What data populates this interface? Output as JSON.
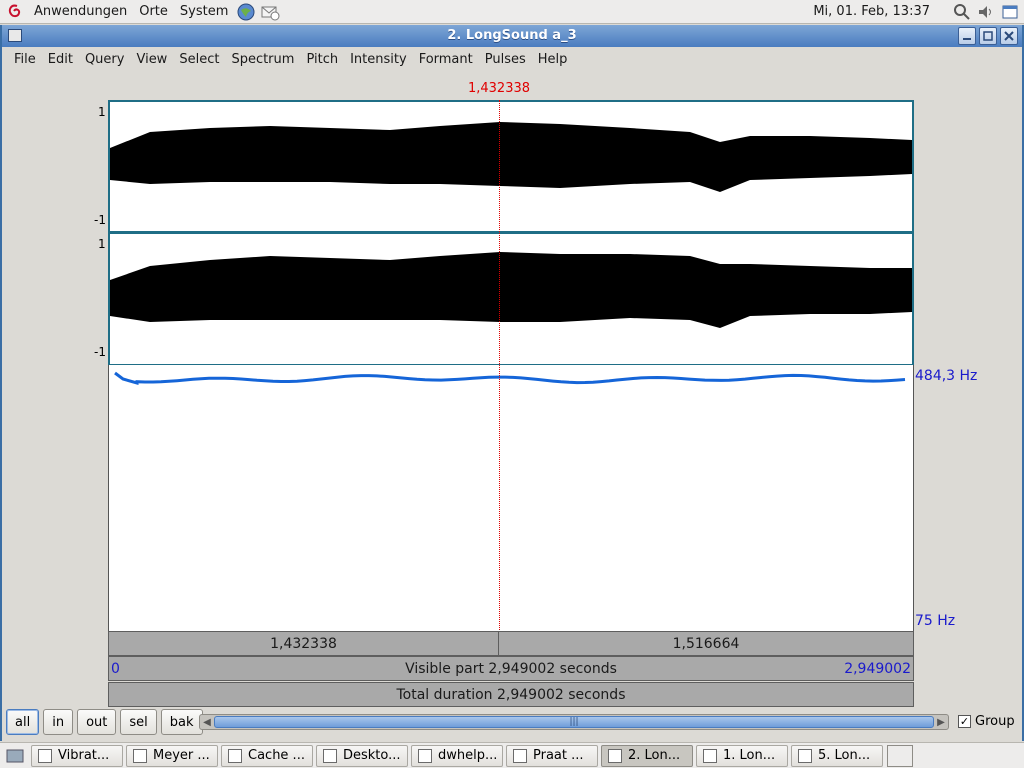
{
  "top_panel": {
    "menus": [
      "Anwendungen",
      "Orte",
      "System"
    ],
    "clock": "Mi, 01. Feb, 13:37"
  },
  "window": {
    "title": "2. LongSound a_3",
    "menubar": [
      "File",
      "Edit",
      "Query",
      "View",
      "Select",
      "Spectrum",
      "Pitch",
      "Intensity",
      "Formant",
      "Pulses",
      "Help"
    ]
  },
  "editor": {
    "cursor_time": "1,432338",
    "channel1": {
      "top": "1",
      "bottom": "-1"
    },
    "channel2": {
      "top": "1",
      "bottom": "-1"
    },
    "pitch_top": "484,3 Hz",
    "pitch_bottom": "75 Hz",
    "left_segment": "1,432338",
    "right_segment": "1,516664",
    "visible_start": "0",
    "visible_text": "Visible part 2,949002 seconds",
    "visible_end": "2,949002",
    "total_text": "Total duration 2,949002 seconds",
    "pitch_color": "#1565d8"
  },
  "controls": {
    "buttons": [
      "all",
      "in",
      "out",
      "sel",
      "bak"
    ],
    "group_label": "Group",
    "group_checked": true
  },
  "taskbar": {
    "tasks": [
      "Vibrat...",
      "Meyer ...",
      "Cache ...",
      "Deskto...",
      "dwhelp...",
      "Praat ...",
      "2. Lon...",
      "1. Lon...",
      "5. Lon..."
    ]
  }
}
